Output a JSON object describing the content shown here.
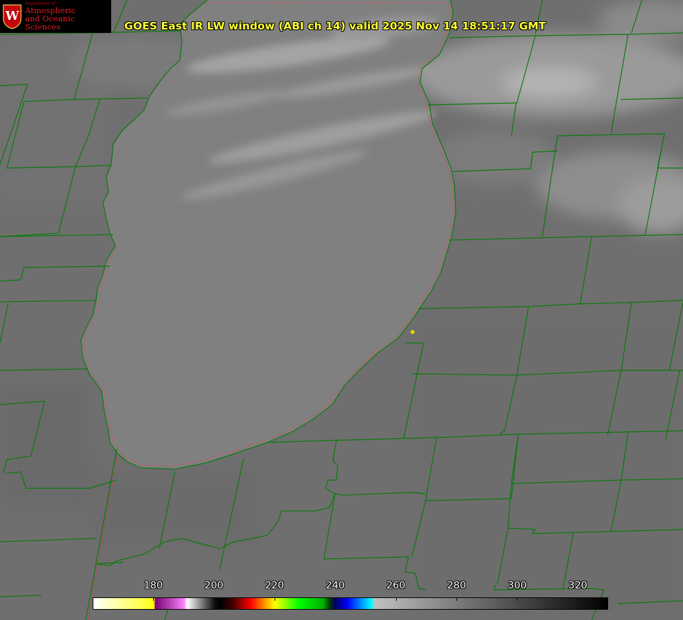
{
  "title": "GOES East IR LW window (ABI ch 14) valid 2025 Nov 14 18:51:17 GMT",
  "logo": {
    "department": "Department of",
    "line1": "Atmospheric",
    "line2": "and Oceanic Sciences",
    "seal_letter": "W"
  },
  "colorbar": {
    "min": 160,
    "max": 330,
    "ticks": [
      "180",
      "200",
      "220",
      "240",
      "260",
      "280",
      "300",
      "320"
    ],
    "tick_values": [
      180,
      200,
      220,
      240,
      260,
      280,
      300,
      320
    ],
    "stops": [
      {
        "v": 160,
        "c": "#ffffff"
      },
      {
        "v": 177,
        "c": "#ffff40"
      },
      {
        "v": 180,
        "c": "#ffff00"
      },
      {
        "v": 180.5,
        "c": "#800080"
      },
      {
        "v": 185,
        "c": "#b040b0"
      },
      {
        "v": 190,
        "c": "#ff80ff"
      },
      {
        "v": 191,
        "c": "#ffffff"
      },
      {
        "v": 200,
        "c": "#101010"
      },
      {
        "v": 202,
        "c": "#000000"
      },
      {
        "v": 206,
        "c": "#400000"
      },
      {
        "v": 212,
        "c": "#ff0000"
      },
      {
        "v": 216,
        "c": "#ff8000"
      },
      {
        "v": 220,
        "c": "#ffff00"
      },
      {
        "v": 224,
        "c": "#80ff00"
      },
      {
        "v": 228,
        "c": "#00ff00"
      },
      {
        "v": 236,
        "c": "#00b000"
      },
      {
        "v": 238,
        "c": "#004000"
      },
      {
        "v": 240,
        "c": "#000060"
      },
      {
        "v": 244,
        "c": "#0000ff"
      },
      {
        "v": 248,
        "c": "#0080ff"
      },
      {
        "v": 252,
        "c": "#00ffff"
      },
      {
        "v": 253,
        "c": "#c0c0c0"
      },
      {
        "v": 330,
        "c": "#000000"
      }
    ]
  },
  "marker": {
    "name": "station",
    "color": "#e6d200"
  },
  "colors": {
    "land": "#6f6f6f",
    "lake": "#808080",
    "cloud": "#a9a9a9",
    "county_lines": "#0a7a0a",
    "lake_outline": "#d04040",
    "title_text": "#ffff33"
  }
}
